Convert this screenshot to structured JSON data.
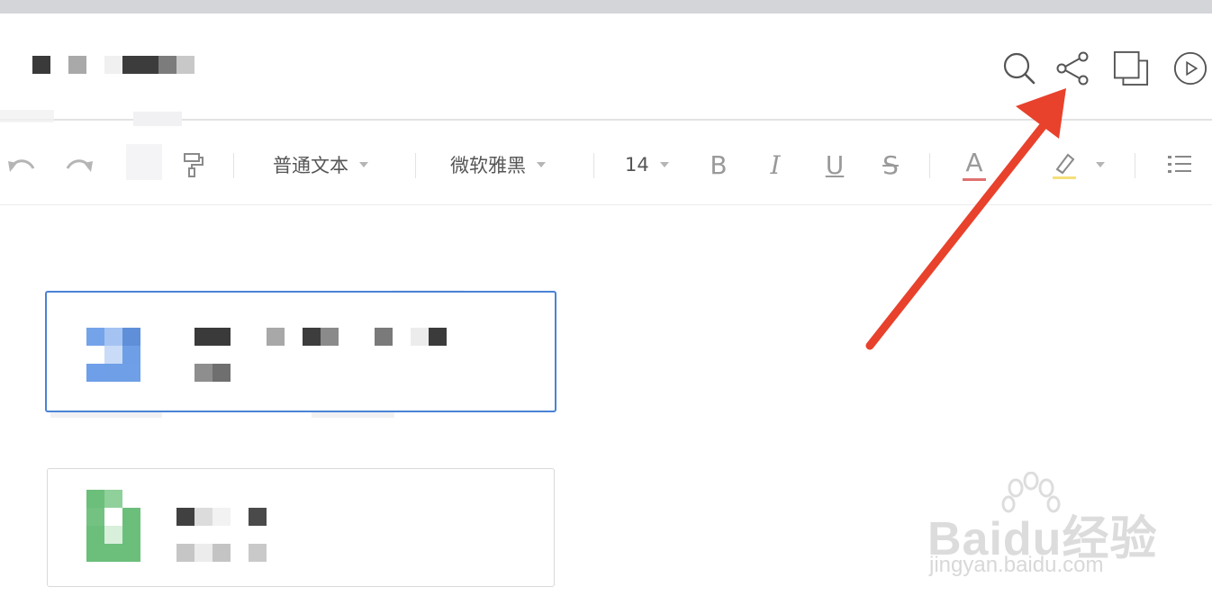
{
  "toolbar": {
    "text_style": "普通文本",
    "font_family": "微软雅黑",
    "font_size": "14",
    "bold_label": "B",
    "italic_label": "I",
    "underline_label": "U",
    "strike_label": "S",
    "font_color_label": "A"
  },
  "header_icons": [
    "search-icon",
    "share-icon",
    "copy-window-icon",
    "play-icon"
  ],
  "colors": {
    "accent_blue": "#4a82d6",
    "arrow_red": "#e8412c",
    "doc_icon_blue": "#6f9fe6",
    "sheet_icon_green": "#6bbf7a"
  },
  "watermark": {
    "brand": "Baidu经验",
    "url": "jingyan.baidu.com"
  }
}
